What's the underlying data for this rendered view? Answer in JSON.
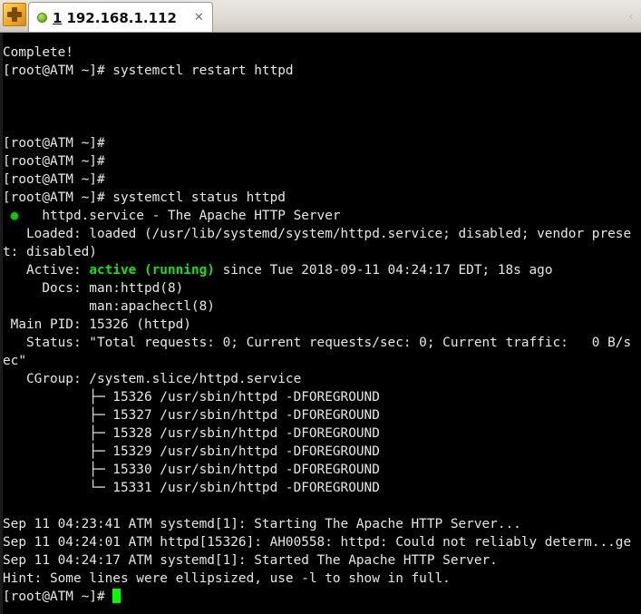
{
  "window": {
    "app_icon": "putty-icon",
    "overflow_indicator": "‹"
  },
  "tab": {
    "status_icon": "green-status-dot",
    "index": "1",
    "title": "192.168.1.112",
    "close_label": "✕"
  },
  "terminal": {
    "prompt": "[root@ATM ~]#",
    "lines": [
      {
        "id": "l01",
        "text": "Complete!"
      },
      {
        "id": "l02",
        "text": "[root@ATM ~]# systemctl restart httpd"
      },
      {
        "id": "l03",
        "text": ""
      },
      {
        "id": "l04",
        "text": ""
      },
      {
        "id": "l05",
        "text": ""
      },
      {
        "id": "l06",
        "text": "[root@ATM ~]#"
      },
      {
        "id": "l07",
        "text": "[root@ATM ~]#"
      },
      {
        "id": "l08",
        "text": "[root@ATM ~]#"
      },
      {
        "id": "l09",
        "text": "[root@ATM ~]# systemctl status httpd"
      },
      {
        "id": "l10",
        "dot": true,
        "text": "   httpd.service - The Apache HTTP Server"
      },
      {
        "id": "l11",
        "text": "   Loaded: loaded (/usr/lib/systemd/system/httpd.service; disabled; vendor prese"
      },
      {
        "id": "l12",
        "text": "t: disabled)"
      },
      {
        "id": "l13",
        "pre": "   Active: ",
        "green": "active (running)",
        "post": " since Tue 2018-09-11 04:24:17 EDT; 18s ago"
      },
      {
        "id": "l14",
        "text": "     Docs: man:httpd(8)"
      },
      {
        "id": "l15",
        "text": "           man:apachectl(8)"
      },
      {
        "id": "l16",
        "text": " Main PID: 15326 (httpd)"
      },
      {
        "id": "l17",
        "text": "   Status: \"Total requests: 0; Current requests/sec: 0; Current traffic:   0 B/s"
      },
      {
        "id": "l18",
        "text": "ec\""
      },
      {
        "id": "l19",
        "text": "   CGroup: /system.slice/httpd.service"
      },
      {
        "id": "l20",
        "text": "           ├─ 15326 /usr/sbin/httpd -DFOREGROUND"
      },
      {
        "id": "l21",
        "text": "           ├─ 15327 /usr/sbin/httpd -DFOREGROUND"
      },
      {
        "id": "l22",
        "text": "           ├─ 15328 /usr/sbin/httpd -DFOREGROUND"
      },
      {
        "id": "l23",
        "text": "           ├─ 15329 /usr/sbin/httpd -DFOREGROUND"
      },
      {
        "id": "l24",
        "text": "           ├─ 15330 /usr/sbin/httpd -DFOREGROUND"
      },
      {
        "id": "l25",
        "text": "           └─ 15331 /usr/sbin/httpd -DFOREGROUND"
      },
      {
        "id": "l26",
        "text": ""
      },
      {
        "id": "l27",
        "text": "Sep 11 04:23:41 ATM systemd[1]: Starting The Apache HTTP Server..."
      },
      {
        "id": "l28",
        "text": "Sep 11 04:24:01 ATM httpd[15326]: AH00558: httpd: Could not reliably determ...ge"
      },
      {
        "id": "l29",
        "text": "Sep 11 04:24:17 ATM systemd[1]: Started The Apache HTTP Server."
      },
      {
        "id": "l30",
        "text": "Hint: Some lines were ellipsized, use -l to show in full."
      },
      {
        "id": "l31",
        "text": "[root@ATM ~]# ",
        "cursor": true
      }
    ]
  },
  "colors": {
    "background": "#000000",
    "foreground": "#e6e6e6",
    "accent_green": "#00d700",
    "cursor_green": "#00ff00",
    "chrome": "#d4d0c8"
  }
}
